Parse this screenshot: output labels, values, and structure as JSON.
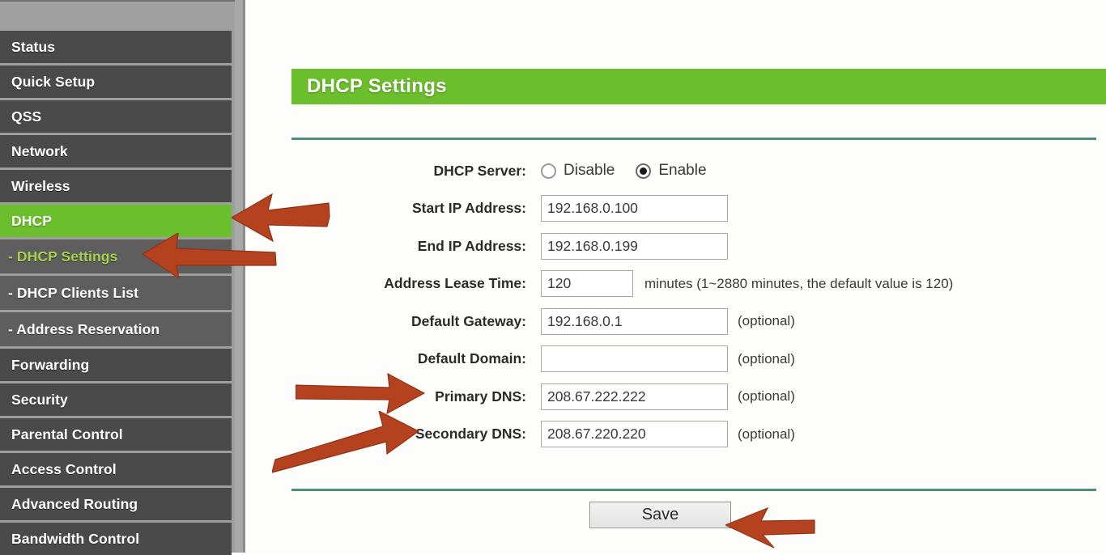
{
  "sidebar": {
    "items": [
      {
        "label": "Status",
        "type": "main",
        "state": "normal"
      },
      {
        "label": "Quick Setup",
        "type": "main",
        "state": "normal"
      },
      {
        "label": "QSS",
        "type": "main",
        "state": "normal"
      },
      {
        "label": "Network",
        "type": "main",
        "state": "normal"
      },
      {
        "label": "Wireless",
        "type": "main",
        "state": "normal"
      },
      {
        "label": "DHCP",
        "type": "main",
        "state": "active"
      },
      {
        "label": "- DHCP Settings",
        "type": "sub",
        "state": "selected"
      },
      {
        "label": "- DHCP Clients List",
        "type": "sub",
        "state": "normal"
      },
      {
        "label": "- Address Reservation",
        "type": "sub",
        "state": "normal"
      },
      {
        "label": "Forwarding",
        "type": "main",
        "state": "normal"
      },
      {
        "label": "Security",
        "type": "main",
        "state": "normal"
      },
      {
        "label": "Parental Control",
        "type": "main",
        "state": "normal"
      },
      {
        "label": "Access Control",
        "type": "main",
        "state": "normal"
      },
      {
        "label": "Advanced Routing",
        "type": "main",
        "state": "normal"
      },
      {
        "label": "Bandwidth Control",
        "type": "main",
        "state": "normal"
      }
    ]
  },
  "main": {
    "panel_title": "DHCP Settings",
    "fields": {
      "dhcp_server": {
        "label": "DHCP Server:",
        "options": [
          "Disable",
          "Enable"
        ],
        "selected": "Enable"
      },
      "start_ip": {
        "label": "Start IP Address:",
        "value": "192.168.0.100",
        "placeholder": ""
      },
      "end_ip": {
        "label": "End IP Address:",
        "value": "192.168.0.199",
        "placeholder": ""
      },
      "lease_time": {
        "label": "Address Lease Time:",
        "value": "120",
        "placeholder": "",
        "hint": "minutes (1~2880 minutes, the default value is 120)"
      },
      "default_gateway": {
        "label": "Default Gateway:",
        "value": "192.168.0.1",
        "placeholder": "",
        "hint": "(optional)"
      },
      "default_domain": {
        "label": "Default Domain:",
        "value": "",
        "placeholder": "",
        "hint": "(optional)"
      },
      "primary_dns": {
        "label": "Primary DNS:",
        "value": "208.67.222.222",
        "placeholder": "",
        "hint": "(optional)"
      },
      "secondary_dns": {
        "label": "Secondary DNS:",
        "value": "208.67.220.220",
        "placeholder": "",
        "hint": "(optional)"
      }
    },
    "save_label": "Save"
  },
  "annotations": {
    "arrow_color": "#b5421f",
    "targets": [
      "DHCP",
      "- DHCP Settings",
      "Primary DNS:",
      "Secondary DNS:",
      "Save"
    ]
  },
  "colors": {
    "brand_green": "#6cbf2c",
    "rule_teal": "#4f8f79",
    "menu_dark": "#4a4a4a",
    "menu_sub": "#5e5e5e",
    "sub_selected_text": "#a8d24a",
    "sidebar_bg": "#9e9e9e"
  }
}
